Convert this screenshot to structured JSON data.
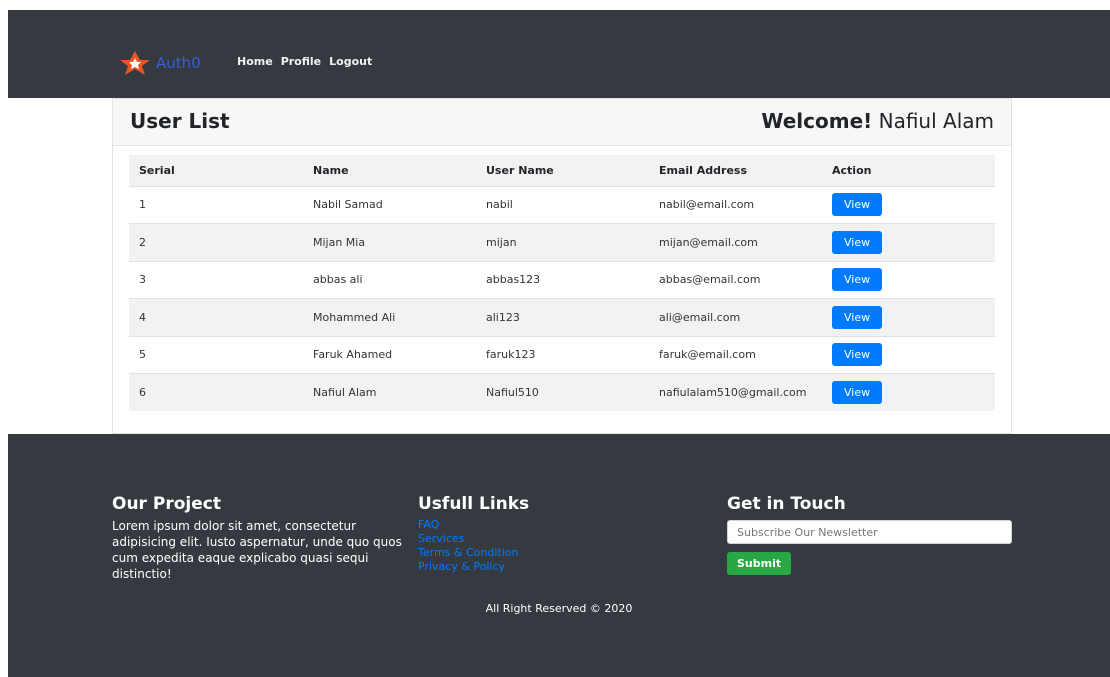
{
  "nav": {
    "brand": "Auth0",
    "links": [
      "Home",
      "Profile",
      "Logout"
    ]
  },
  "card": {
    "title": "User List",
    "welcome_prefix": "Welcome!",
    "welcome_name": "Nafiul Alam"
  },
  "table": {
    "headers": [
      "Serial",
      "Name",
      "User Name",
      "Email Address",
      "Action"
    ],
    "rows": [
      {
        "serial": "1",
        "name": "Nabil Samad",
        "username": "nabil",
        "email": "nabil@email.com",
        "action": "View"
      },
      {
        "serial": "2",
        "name": "Mijan Mia",
        "username": "mijan",
        "email": "mijan@email.com",
        "action": "View"
      },
      {
        "serial": "3",
        "name": "abbas ali",
        "username": "abbas123",
        "email": "abbas@email.com",
        "action": "View"
      },
      {
        "serial": "4",
        "name": "Mohammed Ali",
        "username": "ali123",
        "email": "ali@email.com",
        "action": "View"
      },
      {
        "serial": "5",
        "name": "Faruk Ahamed",
        "username": "faruk123",
        "email": "faruk@email.com",
        "action": "View"
      },
      {
        "serial": "6",
        "name": "Nafiul Alam",
        "username": "Nafiul510",
        "email": "nafiulalam510@gmail.com",
        "action": "View"
      }
    ]
  },
  "footer": {
    "project_title": "Our Project",
    "project_text": "Lorem ipsum dolor sit amet, consectetur adipisicing elit. Iusto aspernatur, unde quo quos cum expedita eaque explicabo quasi sequi distinctio!",
    "links_title": "Usfull Links",
    "links": [
      "FAQ",
      "Services",
      "Terms & Condition",
      "Privacy & Policy"
    ],
    "touch_title": "Get in Touch",
    "newsletter_placeholder": "Subscribe Our Newsletter",
    "submit_label": "Submit",
    "copyright": "All Right Reserved © 2020"
  },
  "colors": {
    "navbar": "#343a40",
    "primary": "#007bff",
    "success": "#28a745",
    "brand_logo": "#eb5424"
  },
  "icons": {
    "brand_logo": "auth0-logo-icon"
  }
}
